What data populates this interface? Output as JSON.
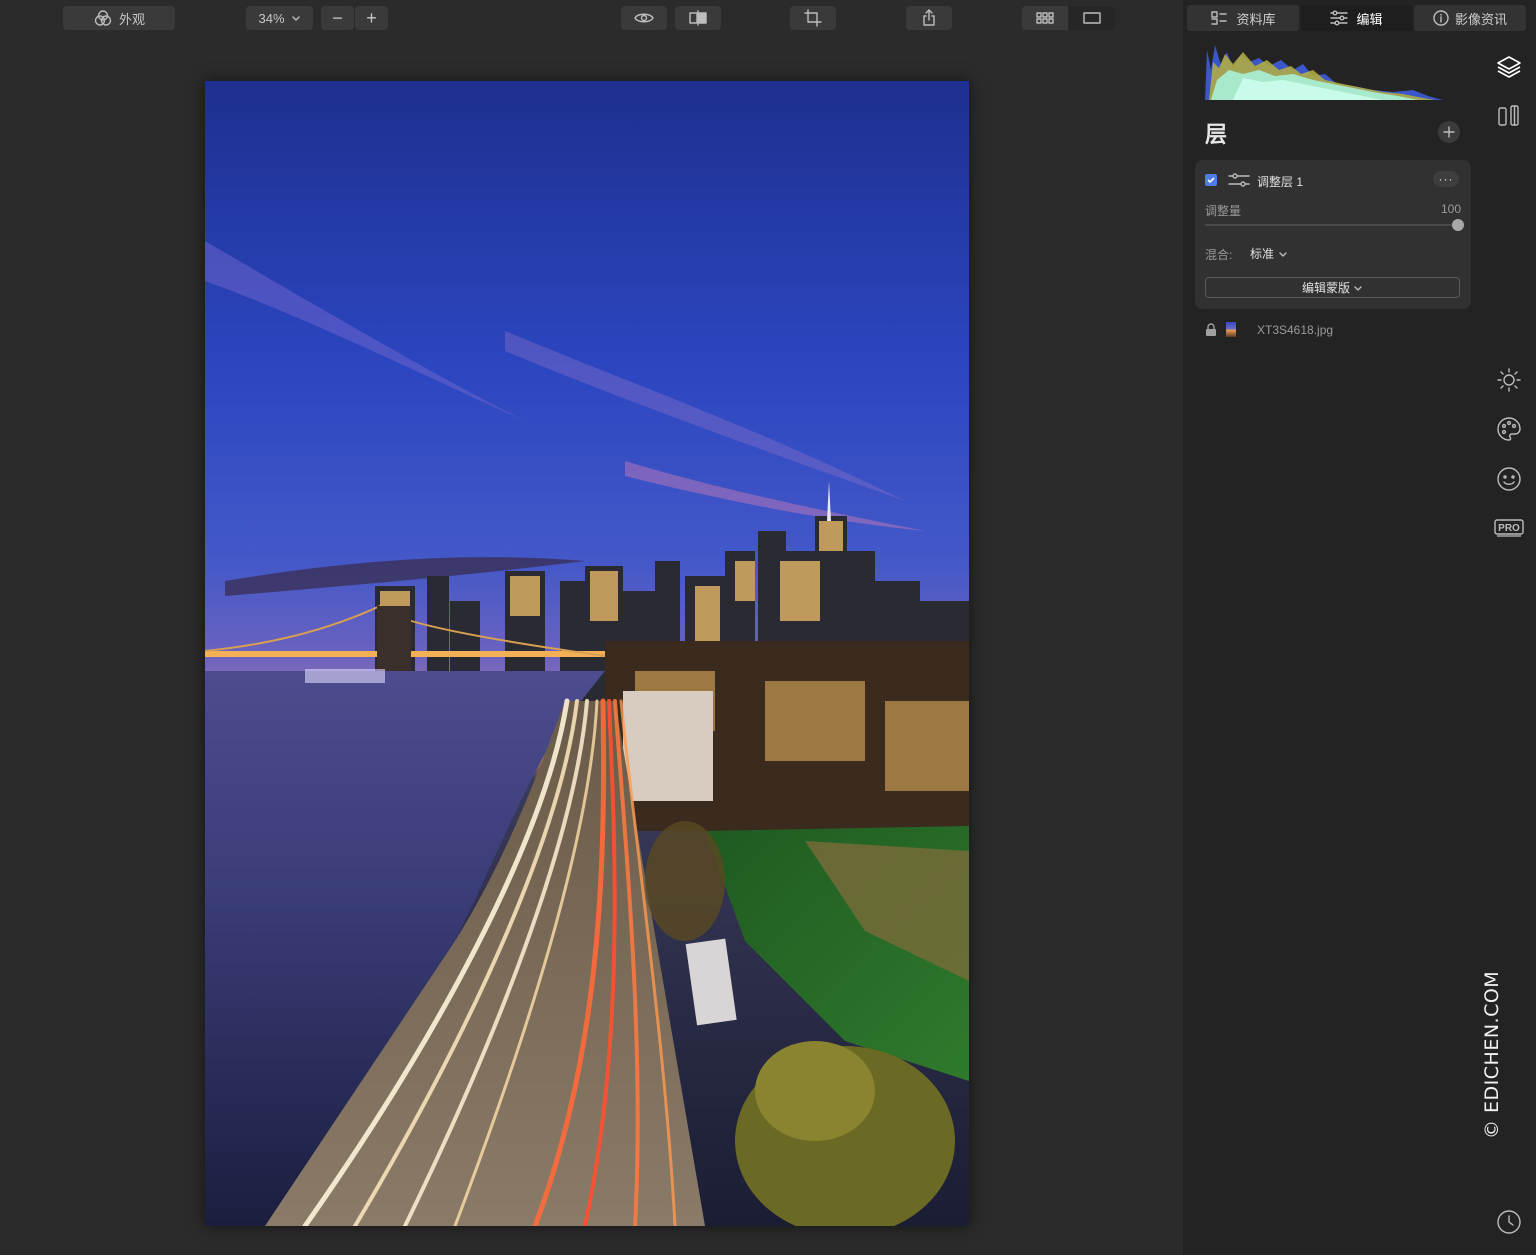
{
  "toolbar": {
    "looks_label": "外观",
    "zoom_label": "34%",
    "zoom_minus": "−",
    "zoom_plus": "+"
  },
  "tabs": {
    "library": "资料库",
    "edit": "编辑",
    "info": "影像资讯"
  },
  "layers": {
    "title": "层",
    "adjustment_layer": {
      "name": "调整层 1",
      "checked": true,
      "amount_label": "调整量",
      "amount_value": "100",
      "amount_fraction": 1.0,
      "blend_label": "混合:",
      "blend_value": "标准",
      "edit_mask_label": "编辑蒙版"
    },
    "base_layer": {
      "filename": "XT3S4618.jpg"
    }
  },
  "watermark": "© EDICHEN.COM",
  "colors": {
    "panel_bg": "#232323",
    "canvas_bg": "#2b2b2b",
    "card_bg": "#313131",
    "accent_check": "#4f7be8"
  },
  "icons": {
    "layers": "layers-icon",
    "presets": "presets-icon",
    "light": "sun-icon",
    "color": "palette-icon",
    "portrait": "face-icon",
    "pro": "pro-icon",
    "history": "clock-icon"
  }
}
